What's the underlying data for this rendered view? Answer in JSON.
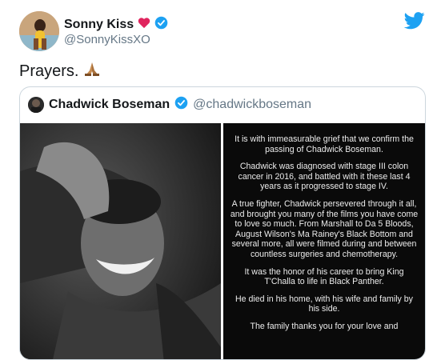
{
  "tweet": {
    "author_name": "Sonny Kiss",
    "author_handle": "@SonnyKissXO",
    "text": "Prayers."
  },
  "quoted": {
    "author_name": "Chadwick Boseman",
    "author_handle": "@chadwickboseman",
    "statement": [
      "It is with immeasurable grief that we confirm the passing of Chadwick Boseman.",
      "Chadwick was diagnosed with stage III colon cancer in 2016, and battled with it these last 4 years as it progressed to stage IV.",
      "A true fighter, Chadwick persevered through it all, and brought you many of the films you have come to love so much. From Marshall to Da 5 Bloods, August Wilson's Ma Rainey's Black Bottom and several more, all were filmed during and between countless surgeries and chemotherapy.",
      "It was the honor of his career to bring King T'Challa to life in Black Panther.",
      "He died in his home, with his wife and family by his side.",
      "The family thanks you for your love and"
    ]
  },
  "colors": {
    "twitter_blue": "#1da1f2",
    "heart_red": "#e0245e",
    "secondary_text": "#657786"
  },
  "icons": [
    "heart-icon",
    "verified-badge-icon",
    "twitter-bird-icon",
    "praying-hands-icon"
  ]
}
